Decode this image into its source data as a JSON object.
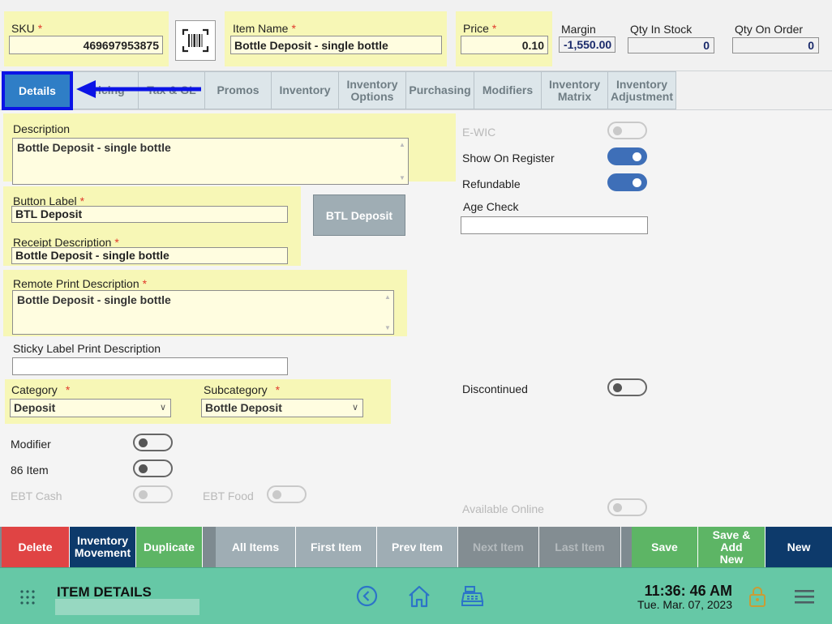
{
  "header": {
    "sku_label": "SKU",
    "sku_value": "469697953875",
    "item_name_label": "Item Name",
    "item_name_value": "Bottle Deposit - single bottle",
    "price_label": "Price",
    "price_value": "0.10",
    "margin_label": "Margin",
    "margin_value": "-1,550.00",
    "qty_in_stock_label": "Qty In Stock",
    "qty_in_stock_value": "0",
    "qty_on_order_label": "Qty On Order",
    "qty_on_order_value": "0",
    "required_mark": "*"
  },
  "tabs": [
    {
      "label": "Details"
    },
    {
      "label": "Pricing"
    },
    {
      "label": "Tax & GL"
    },
    {
      "label": "Promos"
    },
    {
      "label": "Inventory"
    },
    {
      "label": "Inventory Options"
    },
    {
      "label": "Purchasing"
    },
    {
      "label": "Modifiers"
    },
    {
      "label": "Inventory Matrix"
    },
    {
      "label": "Inventory Adjustment"
    }
  ],
  "details": {
    "description_label": "Description",
    "description_value": "Bottle Deposit - single bottle",
    "button_label_label": "Button Label",
    "button_label_value": "BTL Deposit",
    "button_preview": "BTL Deposit",
    "receipt_desc_label": "Receipt Description",
    "receipt_desc_value": "Bottle Deposit - single bottle",
    "remote_print_label": "Remote Print Description",
    "remote_print_value": "Bottle Deposit - single bottle",
    "sticky_label": "Sticky Label Print Description",
    "sticky_value": "",
    "category_label": "Category",
    "category_value": "Deposit",
    "subcategory_label": "Subcategory",
    "subcategory_value": "Bottle Deposit",
    "modifier_label": "Modifier",
    "item86_label": "86 Item",
    "ebt_cash_label": "EBT Cash",
    "ebt_food_label": "EBT Food",
    "ewic_label": "E-WIC",
    "show_on_register_label": "Show On Register",
    "refundable_label": "Refundable",
    "age_check_label": "Age Check",
    "age_check_value": "",
    "discontinued_label": "Discontinued",
    "available_online_label": "Available Online"
  },
  "actions": {
    "delete": "Delete",
    "inventory_movement": "Inventory Movement",
    "duplicate": "Duplicate",
    "all_items": "All Items",
    "first_item": "First Item",
    "prev_item": "Prev Item",
    "next_item": "Next Item",
    "last_item": "Last Item",
    "save": "Save",
    "save_add_new": "Save & Add New",
    "new": "New"
  },
  "footer": {
    "screen_title": "ITEM DETAILS",
    "time": "11:36: 46 AM",
    "date": "Tue. Mar. 07, 2023"
  },
  "colors": {
    "highlight": "#f7f7b6",
    "active_tab": "#2f7ec6",
    "annotation_blue": "#0b14e6",
    "toggle_on": "#3e6fb8",
    "delete": "#e04444",
    "dark_navy": "#0d3a6b",
    "green": "#5db565",
    "footer": "#66c8a6"
  },
  "icons": [
    "barcode-icon",
    "apps-grid-icon",
    "back-circle-icon",
    "home-icon",
    "cash-register-icon",
    "lock-icon",
    "hamburger-menu-icon",
    "annotation-arrow-icon"
  ]
}
